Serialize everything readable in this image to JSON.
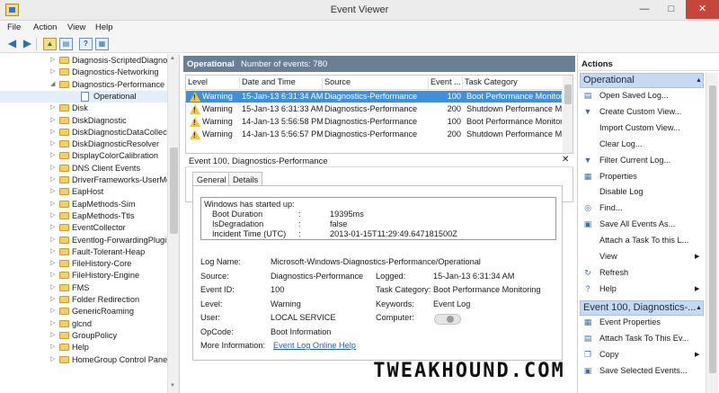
{
  "window": {
    "title": "Event Viewer",
    "min": "—",
    "max": "□",
    "close": "✕"
  },
  "menu": [
    {
      "label": "File"
    },
    {
      "label": "Action"
    },
    {
      "label": "View"
    },
    {
      "label": "Help"
    }
  ],
  "toolbar": {
    "back_icon": "back-arrow-icon",
    "forward_icon": "forward-arrow-icon",
    "folder_icon": "folder-up-icon",
    "properties_icon": "properties-icon",
    "help_icon": "help-icon",
    "show_hide_icon": "show-hide-icon"
  },
  "tree": {
    "items": [
      {
        "label": "Diagnosis-ScriptedDiagnost",
        "type": "folder",
        "arrow": "▷"
      },
      {
        "label": "Diagnostics-Networking",
        "type": "folder",
        "arrow": "▷"
      },
      {
        "label": "Diagnostics-Performance",
        "type": "folder",
        "arrow": "◢"
      },
      {
        "label": "Operational",
        "type": "log",
        "arrow": "",
        "selected": true
      },
      {
        "label": "Disk",
        "type": "folder",
        "arrow": "▷"
      },
      {
        "label": "DiskDiagnostic",
        "type": "folder",
        "arrow": "▷"
      },
      {
        "label": "DiskDiagnosticDataCollecto",
        "type": "folder",
        "arrow": "▷"
      },
      {
        "label": "DiskDiagnosticResolver",
        "type": "folder",
        "arrow": "▷"
      },
      {
        "label": "DisplayColorCalibration",
        "type": "folder",
        "arrow": "▷"
      },
      {
        "label": "DNS Client Events",
        "type": "folder",
        "arrow": "▷"
      },
      {
        "label": "DriverFrameworks-UserMoc",
        "type": "folder",
        "arrow": "▷"
      },
      {
        "label": "EapHost",
        "type": "folder",
        "arrow": "▷"
      },
      {
        "label": "EapMethods-Sim",
        "type": "folder",
        "arrow": "▷"
      },
      {
        "label": "EapMethods-Ttls",
        "type": "folder",
        "arrow": "▷"
      },
      {
        "label": "EventCollector",
        "type": "folder",
        "arrow": "▷"
      },
      {
        "label": "Eventlog-ForwardingPlugin",
        "type": "folder",
        "arrow": "▷"
      },
      {
        "label": "Fault-Tolerant-Heap",
        "type": "folder",
        "arrow": "▷"
      },
      {
        "label": "FileHistory-Core",
        "type": "folder",
        "arrow": "▷"
      },
      {
        "label": "FileHistory-Engine",
        "type": "folder",
        "arrow": "▷"
      },
      {
        "label": "FMS",
        "type": "folder",
        "arrow": "▷"
      },
      {
        "label": "Folder Redirection",
        "type": "folder",
        "arrow": "▷"
      },
      {
        "label": "GenericRoaming",
        "type": "folder",
        "arrow": "▷"
      },
      {
        "label": "glcnd",
        "type": "folder",
        "arrow": "▷"
      },
      {
        "label": "GroupPolicy",
        "type": "folder",
        "arrow": "▷"
      },
      {
        "label": "Help",
        "type": "folder",
        "arrow": "▷"
      },
      {
        "label": "HomeGroup Control Panel",
        "type": "folder",
        "arrow": "▷"
      }
    ]
  },
  "center": {
    "log_name": "Operational",
    "event_count": "Number of events: 780",
    "columns": [
      "Level",
      "Date and Time",
      "Source",
      "Event ...",
      "Task Category"
    ],
    "rows": [
      {
        "level": "Warning",
        "date": "15-Jan-13 6:31:34 AM",
        "source": "Diagnostics-Performance",
        "event": "100",
        "task": "Boot Performance Monitor",
        "selected": true
      },
      {
        "level": "Warning",
        "date": "15-Jan-13 6:31:33 AM",
        "source": "Diagnostics-Performance",
        "event": "200",
        "task": "Shutdown Performance Mo"
      },
      {
        "level": "Warning",
        "date": "14-Jan-13 5:56:58 PM",
        "source": "Diagnostics-Performance",
        "event": "100",
        "task": "Boot Performance Monitor"
      },
      {
        "level": "Warning",
        "date": "14-Jan-13 5:56:57 PM",
        "source": "Diagnostics-Performance",
        "event": "200",
        "task": "Shutdown Performance Mo"
      }
    ],
    "detail_title": "Event 100, Diagnostics-Performance",
    "tabs": [
      "General",
      "Details"
    ],
    "description": {
      "heading": "Windows has started up:",
      "fields": [
        {
          "name": "Boot Duration",
          "sep": ":",
          "value": "19395ms"
        },
        {
          "name": "IsDegradation",
          "sep": ":",
          "value": "false"
        },
        {
          "name": "Incident Time (UTC)",
          "sep": ":",
          "value": "2013-01-15T11:29:49.647181500Z"
        }
      ]
    },
    "props": {
      "log_name_label": "Log Name:",
      "log_name_value": "Microsoft-Windows-Diagnostics-Performance/Operational",
      "source_label": "Source:",
      "source_value": "Diagnostics-Performance",
      "logged_label": "Logged:",
      "logged_value": "15-Jan-13 6:31:34 AM",
      "event_id_label": "Event ID:",
      "event_id_value": "100",
      "task_label": "Task Category:",
      "task_value": "Boot Performance Monitoring",
      "level_label": "Level:",
      "level_value": "Warning",
      "keywords_label": "Keywords:",
      "keywords_value": "Event Log",
      "user_label": "User:",
      "user_value": "LOCAL SERVICE",
      "computer_label": "Computer:",
      "opcode_label": "OpCode:",
      "opcode_value": "Boot Information",
      "more_info_label": "More Information:",
      "more_info_link": "Event Log Online Help"
    },
    "watermark": "TWEAKHOUND.COM"
  },
  "actions": {
    "header": "Actions",
    "section1": "Operational",
    "items1": [
      {
        "label": "Open Saved Log...",
        "icon": "folder-open-icon",
        "glyph": "▤"
      },
      {
        "label": "Create Custom View...",
        "icon": "filter-icon",
        "glyph": "▼"
      },
      {
        "label": "Import Custom View...",
        "icon": "import-icon",
        "glyph": ""
      },
      {
        "label": "Clear Log...",
        "icon": "clear-icon",
        "glyph": ""
      },
      {
        "label": "Filter Current Log...",
        "icon": "filter-icon",
        "glyph": "▼"
      },
      {
        "label": "Properties",
        "icon": "properties-icon",
        "glyph": "▦"
      },
      {
        "label": "Disable Log",
        "icon": "disable-icon",
        "glyph": ""
      },
      {
        "label": "Find...",
        "icon": "find-icon",
        "glyph": "◎"
      },
      {
        "label": "Save All Events As...",
        "icon": "save-icon",
        "glyph": "▣"
      },
      {
        "label": "Attach a Task To this L...",
        "icon": "attach-task-icon",
        "glyph": ""
      },
      {
        "label": "View",
        "icon": "view-icon",
        "glyph": "",
        "submenu": true
      },
      {
        "label": "Refresh",
        "icon": "refresh-icon",
        "glyph": "↻"
      },
      {
        "label": "Help",
        "icon": "help-icon",
        "glyph": "?",
        "submenu": true
      }
    ],
    "section2": "Event 100, Diagnostics-...",
    "items2": [
      {
        "label": "Event Properties",
        "icon": "event-properties-icon",
        "glyph": "▦"
      },
      {
        "label": "Attach Task To This Ev...",
        "icon": "attach-task-icon",
        "glyph": "▤"
      },
      {
        "label": "Copy",
        "icon": "copy-icon",
        "glyph": "❐",
        "submenu": true
      },
      {
        "label": "Save Selected Events...",
        "icon": "save-icon",
        "glyph": "▣"
      }
    ]
  },
  "colors": {
    "selection": "#3f8fdc",
    "header": "#6a7f94",
    "section": "#c6d9f2",
    "warning": "#f3c632",
    "link": "#1e5fc2"
  }
}
